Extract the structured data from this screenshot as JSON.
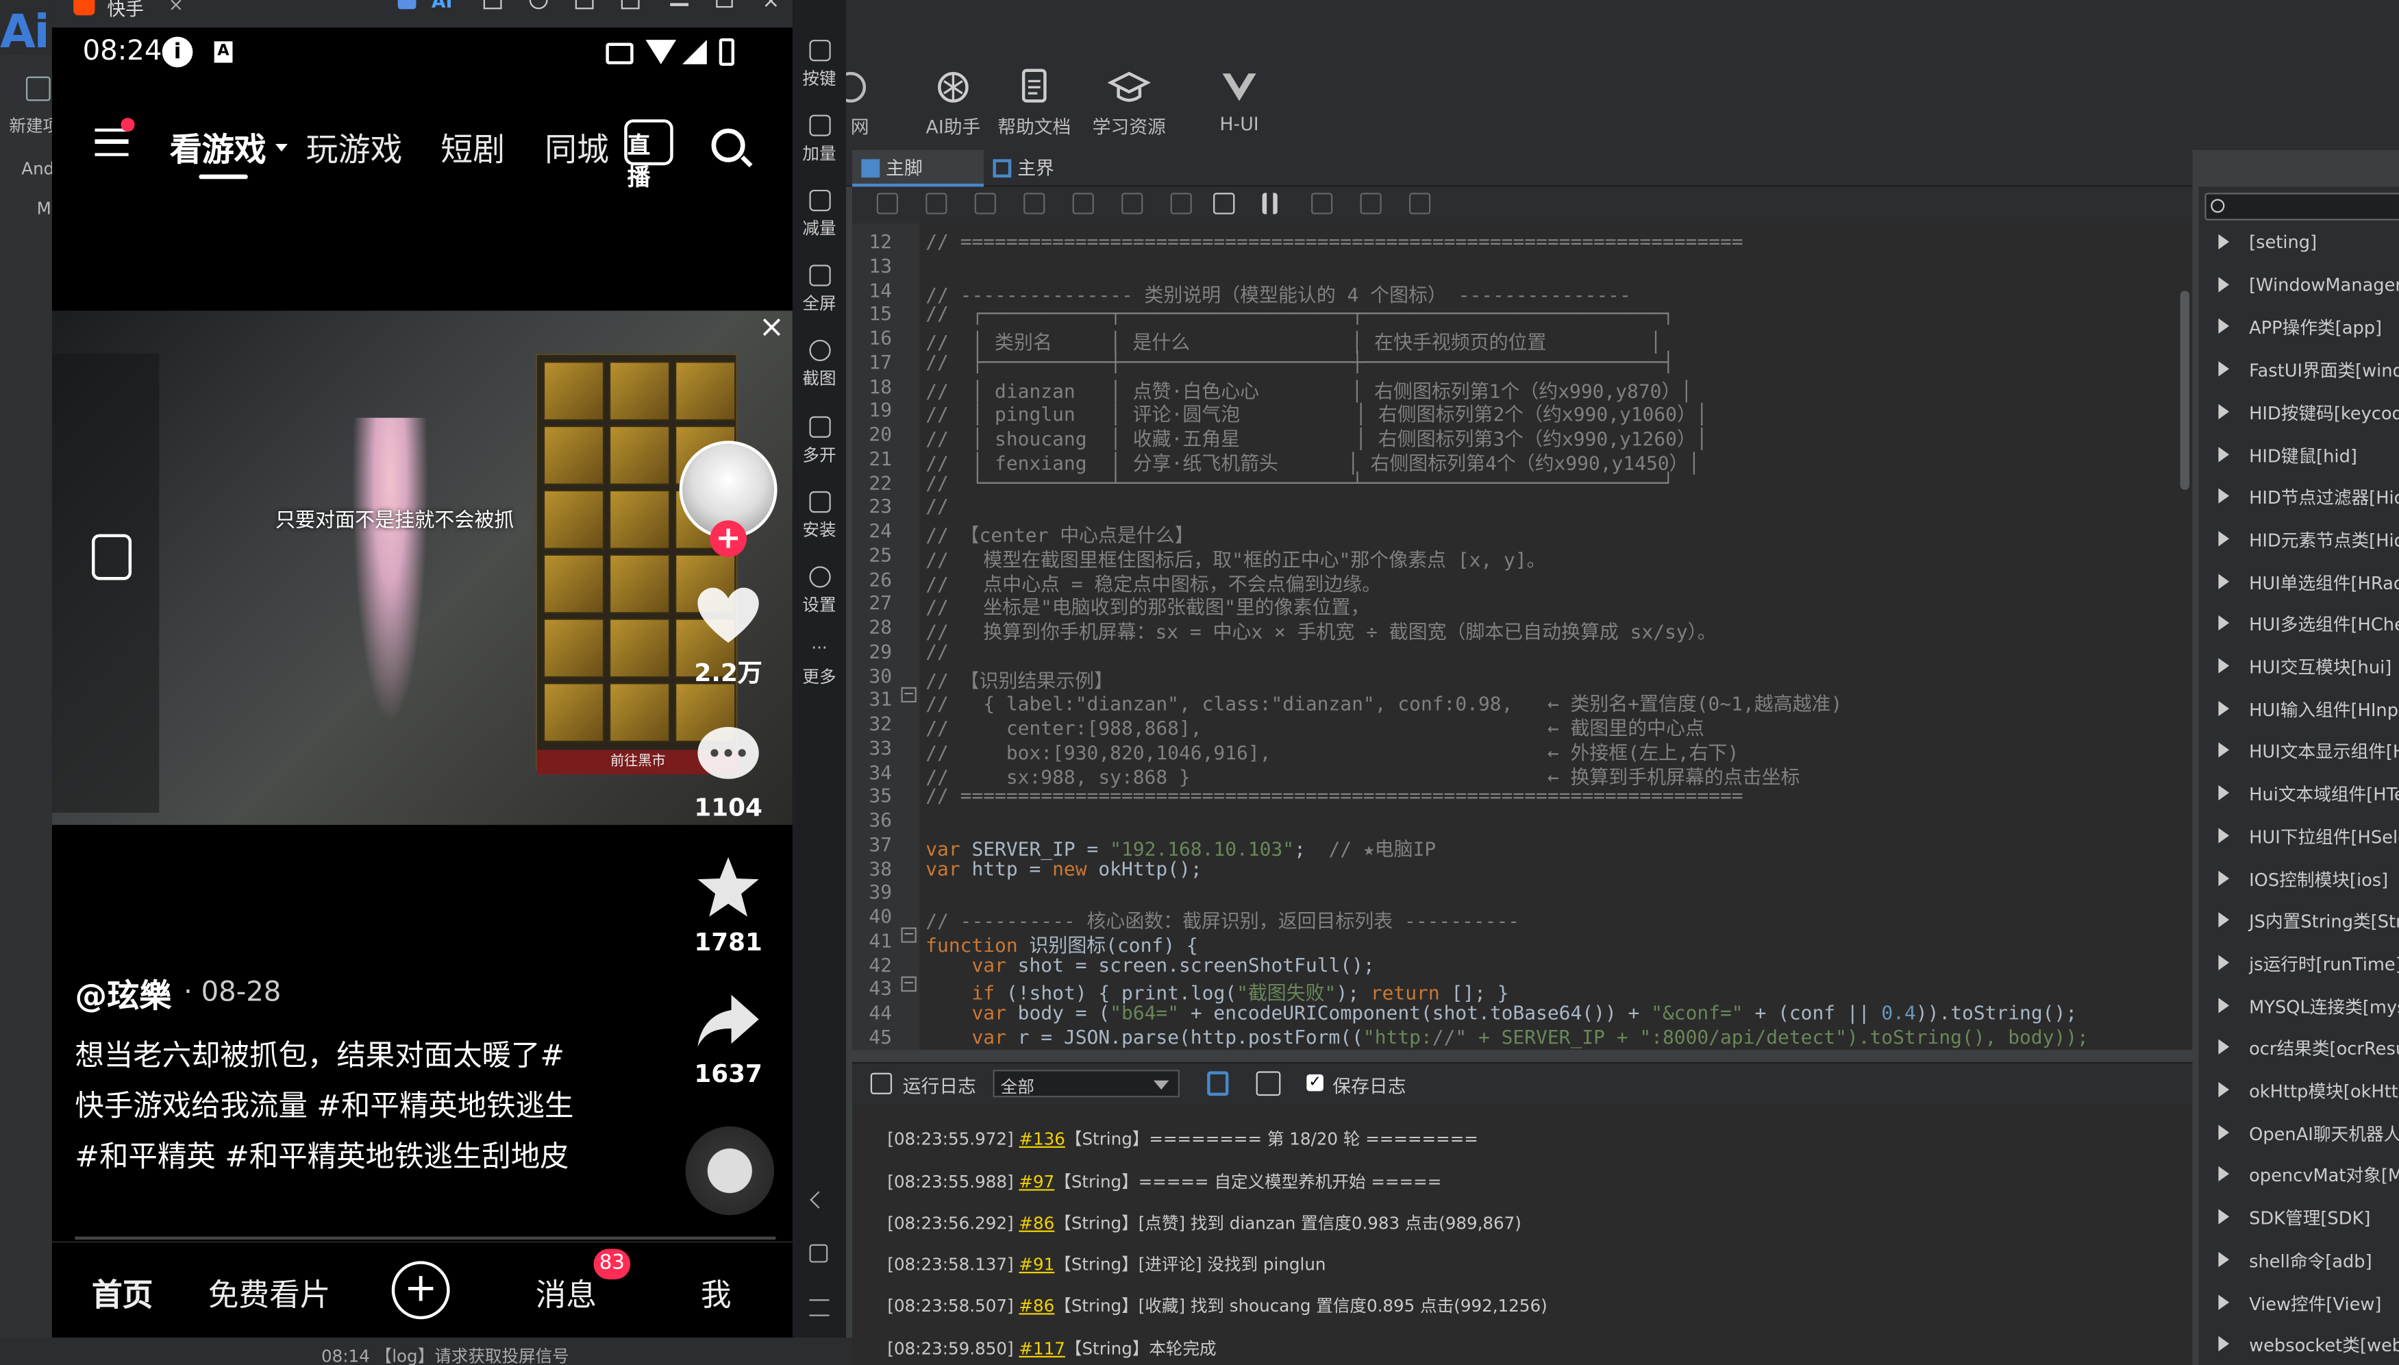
{
  "ide": {
    "logo": "Ai",
    "left_labels": [
      "新建项",
      "And",
      "M"
    ],
    "toolbar": [
      {
        "label": "网",
        "icon": "web-icon"
      },
      {
        "label": "AI助手",
        "icon": "openai-icon"
      },
      {
        "label": "帮助文档",
        "icon": "document-icon"
      },
      {
        "label": "学习资源",
        "icon": "graduation-cap-icon"
      },
      {
        "label": "H-UI",
        "icon": "vue-logo-icon"
      }
    ],
    "tabs": [
      {
        "label": "主脚本.js",
        "active": true
      },
      {
        "label": "主界面.ui",
        "active": false
      }
    ]
  },
  "editor": {
    "first_line": 12,
    "lines": [
      "// ====================================================================",
      "",
      "// --------------- 类别说明（模型能认的 4 个图标） ---------------",
      "//  ┌───────────┬────────────────────┬──────────────────────────┐",
      "//  │ 类别名     │ 是什么              │ 在快手视频页的位置         │",
      "//  ├───────────┼────────────────────┼──────────────────────────┤",
      "//  │ dianzan   │ 点赞·白色心心        │ 右侧图标列第1个（约x990,y870）│",
      "//  │ pinglun   │ 评论·圆气泡          │ 右侧图标列第2个（约x990,y1060）│",
      "//  │ shoucang  │ 收藏·五角星          │ 右侧图标列第3个（约x990,y1260）│",
      "//  │ fenxiang  │ 分享·纸飞机箭头      │ 右侧图标列第4个（约x990,y1450）│",
      "//  └───────────┴────────────────────┴──────────────────────────┘",
      "//",
      "// 【center 中心点是什么】",
      "//   模型在截图里框住图标后，取\"框的正中心\"那个像素点 [x, y]。",
      "//   点中心点 = 稳定点中图标，不会点偏到边缘。",
      "//   坐标是\"电脑收到的那张截图\"里的像素位置，",
      "//   换算到你手机屏幕：sx = 中心x × 手机宽 ÷ 截图宽（脚本已自动换算成 sx/sy）。",
      "//",
      "// 【识别结果示例】",
      "//   { label:\"dianzan\", class:\"dianzan\", conf:0.98,   ← 类别名+置信度(0~1,越高越准)",
      "//     center:[988,868],                              ← 截图里的中心点",
      "//     box:[930,820,1046,916],                        ← 外接框(左上,右下)",
      "//     sx:988, sy:868 }                               ← 换算到手机屏幕的点击坐标",
      "// ====================================================================",
      "",
      "var SERVER_IP = \"192.168.10.103\";  // ★电脑IP",
      "var http = new okHttp();",
      "",
      "// ---------- 核心函数：截屏识别，返回目标列表 ----------",
      "function 识别图标(conf) {",
      "    var shot = screen.screenShotFull();",
      "    if (!shot) { print.log(\"截图失败\"); return []; }",
      "    var body = (\"b64=\" + encodeURIComponent(shot.toBase64()) + \"&conf=\" + (conf || 0.4)).toString();",
      "    var r = JSON.parse(http.postForm((\"http://\" + SERVER_IP + \":8000/api/detect\").toString(), body));"
    ]
  },
  "log": {
    "title": "运行日志",
    "filter": "全部",
    "save_label": "保存日志",
    "save_checked": true,
    "lines": [
      {
        "time": "[08:23:55.972]",
        "ref": "#136",
        "text": "【String】======== 第 18/20 轮 ========"
      },
      {
        "time": "[08:23:55.988]",
        "ref": "#97",
        "text": "【String】===== 自定义模型养机开始 ====="
      },
      {
        "time": "[08:23:56.292]",
        "ref": "#86",
        "text": "【String】[点赞] 找到 dianzan 置信度0.983 点击(989,867)"
      },
      {
        "time": "[08:23:58.137]",
        "ref": "#91",
        "text": "【String】[进评论] 没找到 pinglun"
      },
      {
        "time": "[08:23:58.507]",
        "ref": "#86",
        "text": "【String】[收藏] 找到 shoucang 置信度0.895 点击(992,1256)"
      },
      {
        "time": "[08:23:59.850]",
        "ref": "#117",
        "text": "【String】本轮完成"
      }
    ]
  },
  "modules": [
    "[seting]",
    "[WindowManager]",
    "APP操作类[app]",
    "FastUI界面类[windo",
    "HID按键码[keycode",
    "HID键鼠[hid]",
    "HID节点过滤器[HidN",
    "HID元素节点类[HidN",
    "HUI单选组件[HRadi",
    "HUI多选组件[HChec",
    "HUI交互模块[hui]",
    "HUI输入组件[HInpu",
    "HUI文本显示组件[Ht",
    "Hui文本域组件[HTex",
    "HUI下拉组件[HSele",
    "IOS控制模块[ios]",
    "JS内置String类[Strin",
    "js运行时[runTime]",
    "MYSQL连接类[mysq",
    "ocr结果类[ocrResult",
    "okHttp模块[okHttp",
    "OpenAI聊天机器人[c",
    "opencvMat对象[Ma",
    "SDK管理[SDK]",
    "shell命令[adb]",
    "View控件[View]",
    "websocket类[webs"
  ],
  "phone": {
    "window_title": "快手",
    "time": "08:24",
    "nav_tabs": [
      "看游戏",
      "玩游戏",
      "短剧",
      "同城"
    ],
    "live_label": "直播",
    "video_overlay_text": "只要对面不是挂就不会被抓",
    "inventory_button": "前往黑市",
    "likes": "2.2万",
    "comments": "1104",
    "stars": "1781",
    "shares": "1637",
    "author": "@玹樂",
    "date": "· 08-28",
    "caption": "想当老六却被抓包，结果对面太暖了#快手游戏给我流量 #和平精英地铁逃生 #和平精英 #和平精英地铁逃生刮地皮",
    "bottom_nav": {
      "home": "首页",
      "free": "免费看片",
      "messages": "消息",
      "messages_badge": "83",
      "me": "我"
    }
  },
  "phone_side": [
    "按键",
    "加量",
    "减量",
    "全屏",
    "截图",
    "多开",
    "安装",
    "设置",
    "更多"
  ],
  "status_bar_text": "08:14 【log】请求获取投屏信号"
}
